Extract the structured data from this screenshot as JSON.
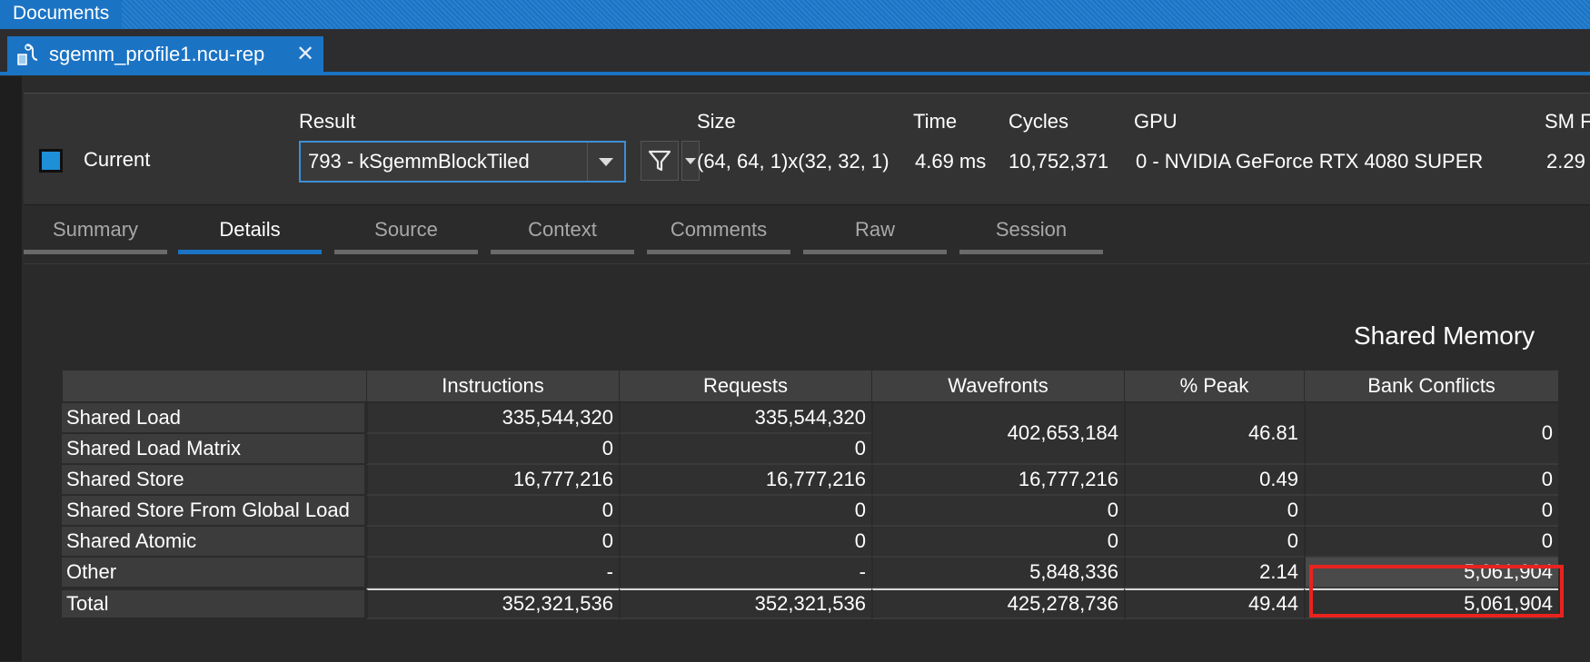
{
  "documents_bar": {
    "title": "Documents"
  },
  "file_tab": {
    "name": "sgemm_profile1.ncu-rep",
    "close_glyph": "✕",
    "icon": "report-file-icon"
  },
  "header": {
    "current_label": "Current",
    "result_label": "Result",
    "result_value": "793 - kSgemmBlockTiled",
    "size_label": "Size",
    "size_value": "(64, 64, 1)x(32, 32, 1)",
    "time_label": "Time",
    "time_value": "4.69 ms",
    "cycles_label": "Cycles",
    "cycles_value": "10,752,371",
    "gpu_label": "GPU",
    "gpu_value": "0 - NVIDIA GeForce RTX 4080 SUPER",
    "sm_label": "SM F",
    "sm_value": "2.29"
  },
  "page_tabs": [
    {
      "label": "Summary",
      "active": false
    },
    {
      "label": "Details",
      "active": true
    },
    {
      "label": "Source",
      "active": false
    },
    {
      "label": "Context",
      "active": false
    },
    {
      "label": "Comments",
      "active": false
    },
    {
      "label": "Raw",
      "active": false
    },
    {
      "label": "Session",
      "active": false
    }
  ],
  "section": {
    "title": "Shared Memory",
    "columns": [
      "Instructions",
      "Requests",
      "Wavefronts",
      "% Peak",
      "Bank Conflicts"
    ],
    "rows": [
      {
        "label": "Shared Load",
        "instructions": "335,544,320",
        "requests": "335,544,320"
      },
      {
        "label": "Shared Load Matrix",
        "instructions": "0",
        "requests": "0"
      },
      {
        "label": "Shared Store",
        "instructions": "16,777,216",
        "requests": "16,777,216",
        "wavefronts": "16,777,216",
        "peak": "0.49",
        "bank_conflicts": "0"
      },
      {
        "label": "Shared Store From Global Load",
        "instructions": "0",
        "requests": "0",
        "wavefronts": "0",
        "peak": "0",
        "bank_conflicts": "0"
      },
      {
        "label": "Shared Atomic",
        "instructions": "0",
        "requests": "0",
        "wavefronts": "0",
        "peak": "0",
        "bank_conflicts": "0"
      },
      {
        "label": "Other",
        "instructions": "-",
        "requests": "-",
        "wavefronts": "5,848,336",
        "peak": "2.14",
        "bank_conflicts": "5,061,904"
      },
      {
        "label": "Total",
        "instructions": "352,321,536",
        "requests": "352,321,536",
        "wavefronts": "425,278,736",
        "peak": "49.44",
        "bank_conflicts": "5,061,904"
      }
    ],
    "merged_load": {
      "wavefronts": "402,653,184",
      "peak": "46.81",
      "bank_conflicts": "0"
    }
  },
  "colors": {
    "accent": "#1b73c4",
    "highlight_box": "#e8231f",
    "checkbox": "#1e90d8"
  }
}
